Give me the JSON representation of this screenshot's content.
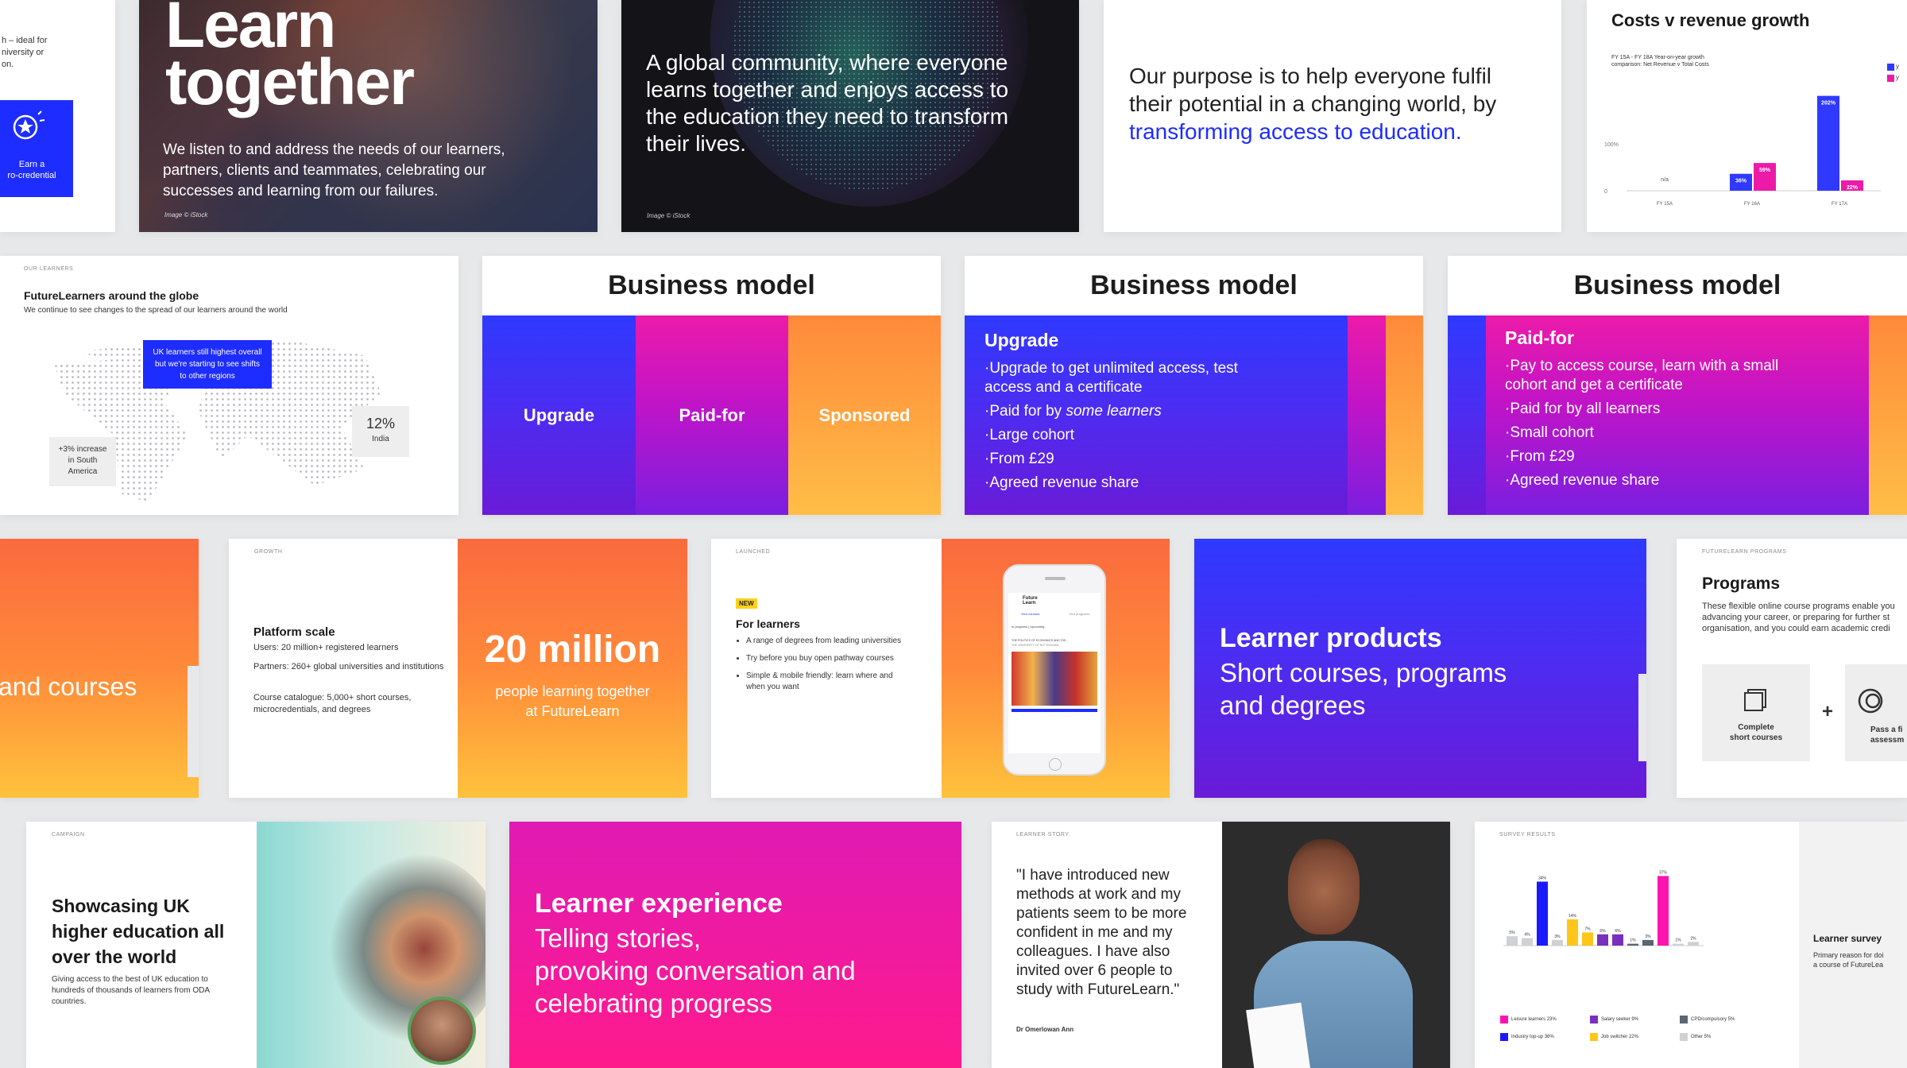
{
  "s1": {
    "top_text": "h – ideal for\nniversity or\non.",
    "badge_label": "Earn a\nro-credential"
  },
  "s2": {
    "title": "Learn\ntogether",
    "body": "We listen to and address the needs of our learners, partners, clients and teammates, celebrating our successes and learning from our failures.",
    "credit": "Image © iStock"
  },
  "s3": {
    "body": "A global community, where everyone learns together and enjoys access to the education they need to transform their lives.",
    "credit": "Image © iStock"
  },
  "s4": {
    "text_before": "Our purpose is to help everyone fulfil their potential in a changing world, by ",
    "text_highlight": "transforming access to education."
  },
  "s5": {
    "title": "Costs v revenue growth",
    "subtitle": "FY 15A - FY 18A Year-on-year growth\ncomparison: Net Revenue v Total Costs",
    "legend": [
      "y",
      "y"
    ],
    "chart_data": {
      "type": "bar",
      "categories": [
        "FY 15A",
        "FY 16A",
        "FY 17A"
      ],
      "series": [
        {
          "values": [
            null,
            36,
            202
          ],
          "color": "#2f39ff",
          "labels": [
            "n/a",
            "36%",
            "202%"
          ]
        },
        {
          "values": [
            null,
            59,
            22
          ],
          "color": "#ec1aa9",
          "labels": [
            "",
            "59%",
            "22%"
          ]
        }
      ],
      "yticks": [
        "0",
        "100%"
      ],
      "ylim": [
        0,
        220
      ]
    }
  },
  "s6": {
    "label": "OUR LEARNERS",
    "title": "FutureLearners around the globe",
    "subtitle": "We continue to see changes to the spread of our learners around the world",
    "callout": "UK learners still highest overall but we're starting to see shifts to other regions",
    "india_pct": "12%",
    "india_label": "India",
    "sa_text": "+3% increase\nin South\nAmerica"
  },
  "s7": {
    "title": "Business model",
    "cols": [
      "Upgrade",
      "Paid-for",
      "Sponsored"
    ]
  },
  "s8": {
    "title": "Business model",
    "heading": "Upgrade",
    "items": [
      "Upgrade to get unlimited access, test access and a certificate",
      "Paid for by ",
      "Large cohort",
      "From £29",
      "Agreed revenue share"
    ],
    "item2_em": "some learners"
  },
  "s9": {
    "title": "Business model",
    "heading": "Paid-for",
    "items": [
      "Pay to access course, learn with a small cohort and get a certificate",
      "Paid for by all learners",
      "Small cohort",
      "From £29",
      "Agreed revenue share"
    ]
  },
  "s10": {
    "text": "and courses"
  },
  "s11": {
    "label": "GROWTH",
    "heading": "Platform scale",
    "users": "Users: 20 million+ registered learners",
    "partners": "Partners: 260+ global universities and institutions",
    "catalogue": "Course catalogue: 5,000+ short courses, microcredentials, and degrees",
    "big": "20 million",
    "big_sub": "people learning together\nat FutureLearn"
  },
  "s12": {
    "label": "LAUNCHED",
    "badge": "NEW",
    "heading": "For learners",
    "items": [
      "A range of degrees from leading universities",
      "Try before you buy open pathway courses",
      "Simple & mobile friendly: learn where and when you want"
    ],
    "phone_logo": "Future\nLearn",
    "phone_tab1": "Your courses",
    "phone_tab2": "Your programs",
    "phone_progress": "In progress",
    "phone_upcoming": "Upcoming",
    "phone_course": "THE POLITICS OF ECONOMICS AND THE...",
    "phone_uni": "THE UNIVERSITY OF NOTTINGHAM"
  },
  "s13": {
    "title": "Learner products",
    "subtitle": "Short courses, programs\nand degrees"
  },
  "s14": {
    "label": "FUTURELEARN PROGRAMS",
    "title": "Programs",
    "body": "These flexible online course programs enable you advancing your career, or preparing for further st organisation, and you could earn academic credi",
    "card1": "Complete\nshort courses",
    "plus": "+",
    "card2": "Pass a fi\nassessm"
  },
  "s15": {
    "label": "CAMPAIGN",
    "title": "Showcasing UK higher education all over the world",
    "body": "Giving access to the best of UK education to hundreds of thousands of learners from ODA countries."
  },
  "s16": {
    "title": "Learner experience",
    "subtitle": "Telling stories,\nprovoking conversation and\ncelebrating progress"
  },
  "s17": {
    "label": "LEARNER STORY",
    "quote": "\"I have introduced new methods at work and my patients seem to be more confident in me and my colleagues. I have also invited over 6 people to study with FutureLearn.\"",
    "author": "Dr Omerlowan Ann"
  },
  "s18": {
    "label": "SURVEY RESULTS",
    "title": "Learner survey",
    "body": "Primary reason for doi\na course of FutureLea",
    "chart_data": {
      "type": "bar",
      "values": [
        5,
        4,
        34,
        3,
        14,
        7,
        6,
        6,
        1,
        3,
        37,
        1,
        2
      ],
      "labels": [
        "5%",
        "4%",
        "34%",
        "3%",
        "14%",
        "7%",
        "6%",
        "6%",
        "1%",
        "3%",
        "37%",
        "1%",
        "2%"
      ],
      "colors": [
        "#cfd1d4",
        "#cfd1d4",
        "#1a1aff",
        "#cfd1d4",
        "#ffc61a",
        "#ffc61a",
        "#7a2fbf",
        "#7a2fbf",
        "#5a6670",
        "#5a6670",
        "#ff14b0",
        "#cfd1d4",
        "#cfd1d4"
      ],
      "legend": [
        {
          "name": "Leisure learners 23%",
          "color": "#ff14b0"
        },
        {
          "name": "Salary seeker 9%",
          "color": "#7a2fbf"
        },
        {
          "name": "CPD/compulsory 5%",
          "color": "#5a6670"
        },
        {
          "name": "Industry top-up 36%",
          "color": "#1a1aff"
        },
        {
          "name": "Job switcher 22%",
          "color": "#ffc61a"
        },
        {
          "name": "Other 5%",
          "color": "#cfd1d4"
        }
      ]
    }
  }
}
